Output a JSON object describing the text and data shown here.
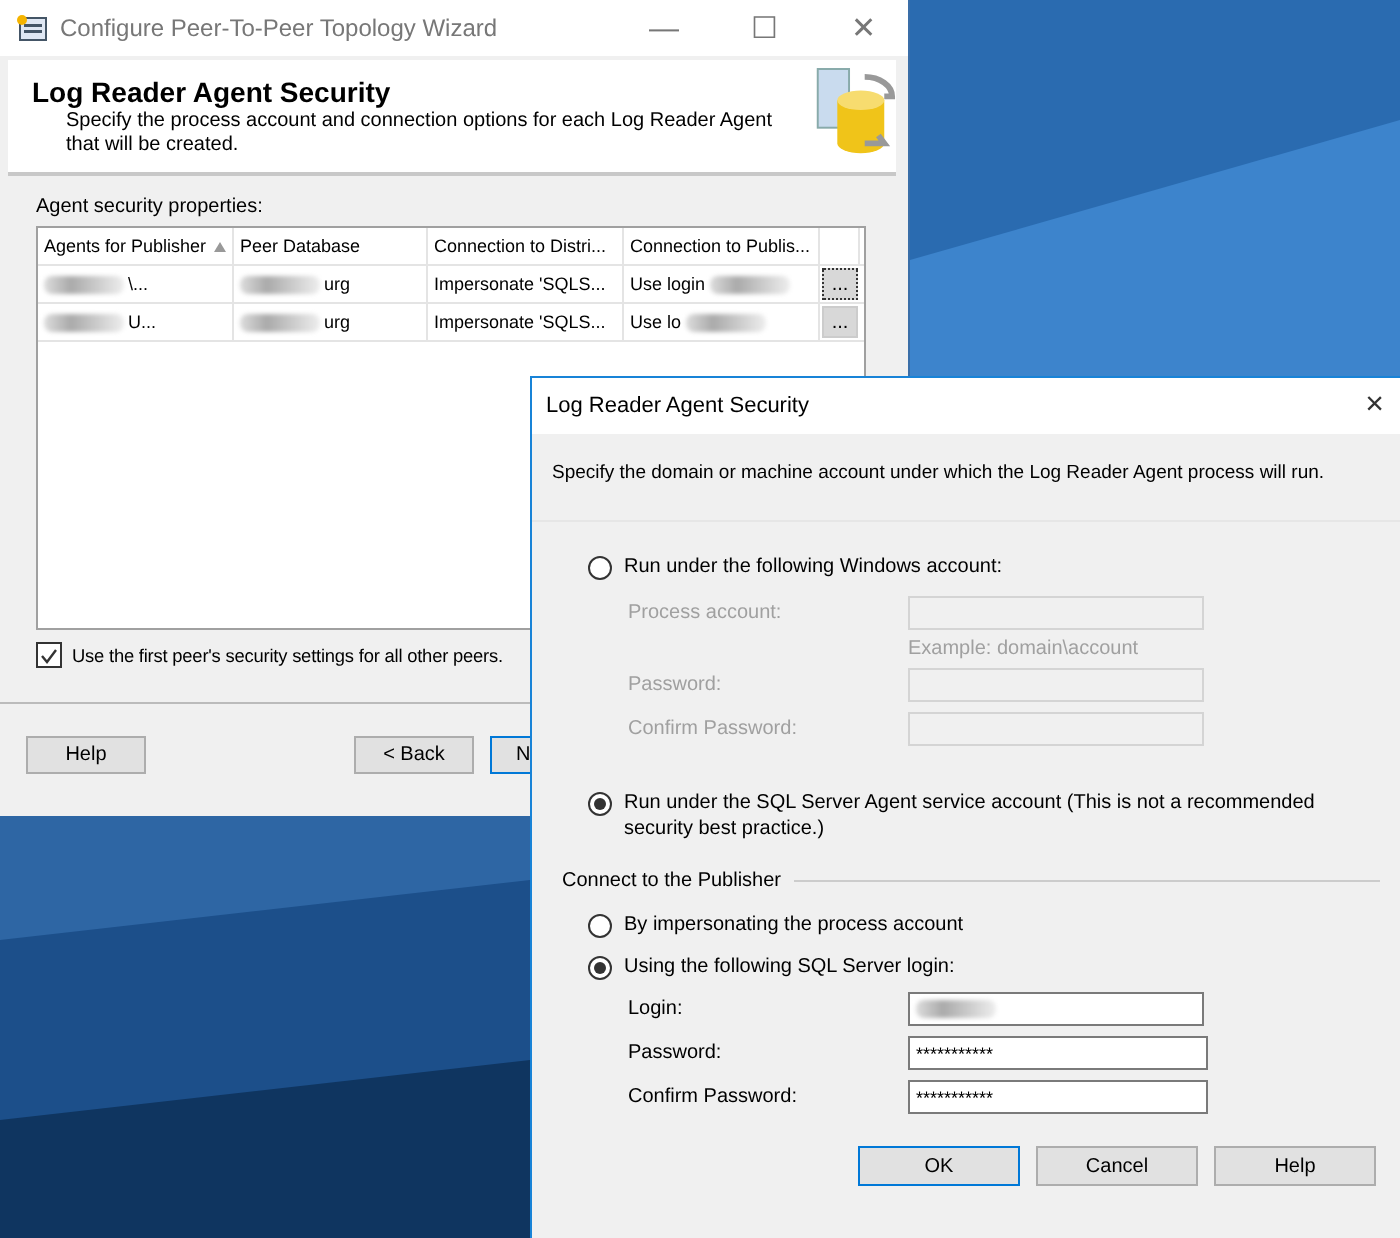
{
  "wizard": {
    "title": "Configure Peer-To-Peer Topology Wizard",
    "caption_buttons": [
      "—",
      "☐",
      "✕"
    ],
    "header": {
      "title": "Log Reader Agent Security",
      "subtitle": "Specify the process account and connection options for each Log Reader Agent that will be created."
    },
    "grid_label": "Agent security properties:",
    "table": {
      "columns": [
        {
          "label": "Agents for Publisher",
          "sorted": true
        },
        {
          "label": "Peer Database"
        },
        {
          "label": "Connection to Distri..."
        },
        {
          "label": "Connection to Publis..."
        }
      ],
      "rows": [
        {
          "cells": [
            {
              "text": "\\...",
              "blurred": true
            },
            {
              "text": "urg",
              "blurred": true
            },
            {
              "text": "Impersonate 'SQLS...",
              "blurred": false
            },
            {
              "text": "Use login",
              "blurred": true
            }
          ],
          "action": "...",
          "focused": true
        },
        {
          "cells": [
            {
              "text": "U...",
              "blurred": true
            },
            {
              "text": "urg",
              "blurred": true
            },
            {
              "text": "Impersonate 'SQLS...",
              "blurred": false
            },
            {
              "text": "Use lo",
              "blurred": true
            }
          ],
          "action": "...",
          "focused": false
        }
      ]
    },
    "checkbox": {
      "label": "Use the first peer's security settings for all other peers.",
      "checked": true
    },
    "buttons": [
      {
        "label": "Help",
        "kind": "left"
      },
      {
        "label": "< Back",
        "kind": "right"
      },
      {
        "label": "N",
        "kind": "covered"
      }
    ]
  },
  "dialog": {
    "title": "Log Reader Agent Security",
    "close": "×",
    "intro": "Specify the domain or machine account under which the Log Reader Agent process will run.",
    "account_options": [
      {
        "label": "Run under the following Windows account:",
        "selected": false
      },
      {
        "label": "Run under the SQL Server Agent service account (This is not a recommended security best practice.)",
        "selected": true
      }
    ],
    "account_fields": [
      {
        "label": "Process account:",
        "disabled": true,
        "hint": "Example: domain\\account"
      },
      {
        "label": "Password:",
        "disabled": true
      },
      {
        "label": "Confirm Password:",
        "disabled": true
      }
    ],
    "publisher_group": "Connect to the Publisher",
    "publisher_options": [
      {
        "label": "By impersonating the process account",
        "selected": false
      },
      {
        "label": "Using the following SQL Server login:",
        "selected": true
      }
    ],
    "login_fields": [
      {
        "label": "Login:",
        "blurred": true
      },
      {
        "label": "Password:",
        "value": "***********"
      },
      {
        "label": "Confirm Password:",
        "value": "***********"
      }
    ],
    "buttons": [
      {
        "label": "OK",
        "default": true
      },
      {
        "label": "Cancel",
        "default": false
      },
      {
        "label": "Help",
        "default": false
      }
    ]
  }
}
